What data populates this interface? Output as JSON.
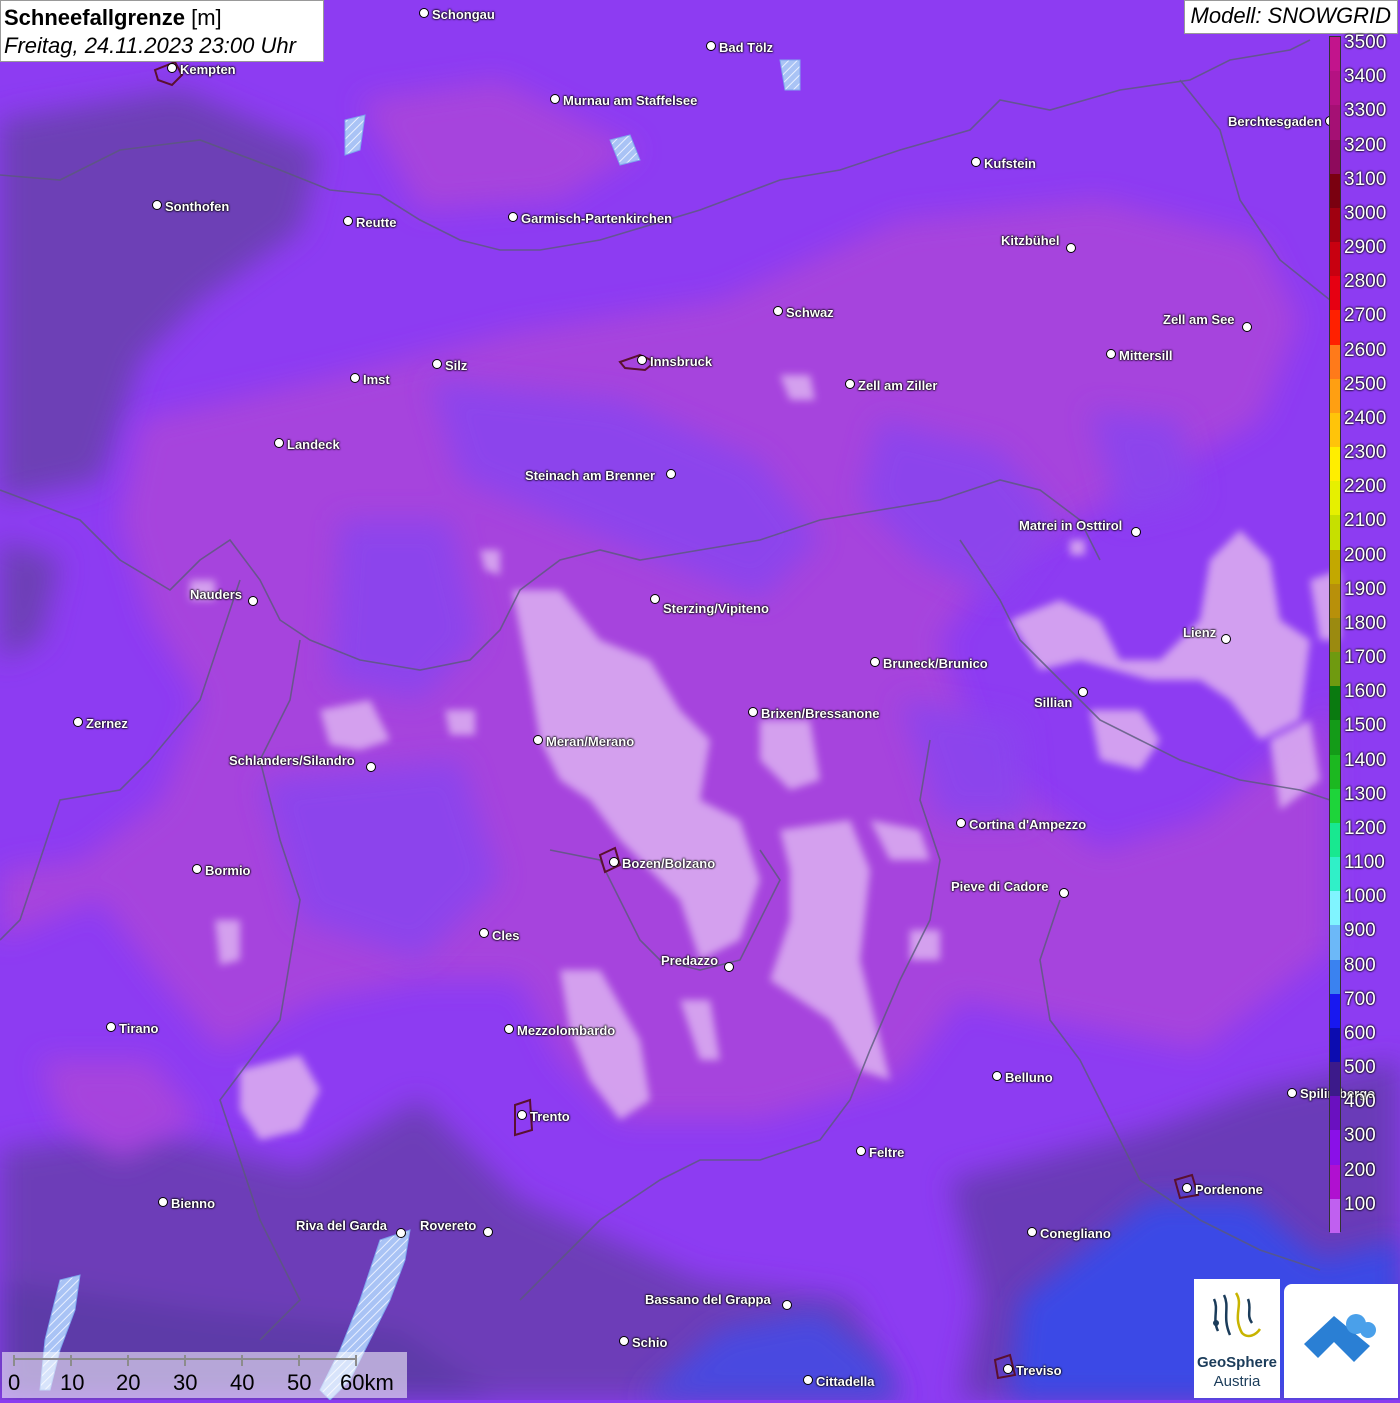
{
  "title": {
    "param": "Schneefallgrenze",
    "unit": "[m]",
    "datetime": "Freitag, 24.11.2023 23:00 Uhr"
  },
  "model": "Modell: SNOWGRID",
  "legend": {
    "labels": [
      "3500",
      "3400",
      "3300",
      "3200",
      "3100",
      "3000",
      "2900",
      "2800",
      "2700",
      "2600",
      "2500",
      "2400",
      "2300",
      "2200",
      "2100",
      "2000",
      "1900",
      "1800",
      "1700",
      "1600",
      "1500",
      "1400",
      "1300",
      "1200",
      "1100",
      "1000",
      "900",
      "800",
      "700",
      "600",
      "500",
      "400",
      "300",
      "200",
      "100"
    ],
    "colors": [
      "#c2148c",
      "#b51282",
      "#a51074",
      "#8e0a5c",
      "#7a0010",
      "#a00010",
      "#c80010",
      "#e60012",
      "#ff2000",
      "#ff7a1a",
      "#ff9f12",
      "#ffc40a",
      "#ffee00",
      "#e6f000",
      "#c6e000",
      "#c3a800",
      "#b8900a",
      "#9b8a10",
      "#6f9a10",
      "#0a7a10",
      "#149b18",
      "#1cb820",
      "#1ed43a",
      "#18e890",
      "#30f0c8",
      "#80f4ff",
      "#6cb8f8",
      "#3a82f0",
      "#1818f0",
      "#0c0cb0",
      "#3c1a8a",
      "#6a10c0",
      "#8a10e8",
      "#b010d0",
      "#c060f0"
    ]
  },
  "cities": [
    {
      "name": "Schongau",
      "dot": [
        424,
        13
      ],
      "label": [
        432,
        15
      ],
      "anchor": "left"
    },
    {
      "name": "Kempten",
      "dot": [
        172,
        68
      ],
      "label": [
        180,
        70
      ],
      "anchor": "left"
    },
    {
      "name": "Bad Tölz",
      "dot": [
        711,
        46
      ],
      "label": [
        719,
        48
      ],
      "anchor": "left"
    },
    {
      "name": "Murnau am Staffelsee",
      "dot": [
        555,
        99
      ],
      "label": [
        563,
        101
      ],
      "anchor": "left"
    },
    {
      "name": "Berchtesgaden",
      "dot": [
        1330,
        121
      ],
      "label": [
        1228,
        122
      ],
      "anchor": "left"
    },
    {
      "name": "Kufstein",
      "dot": [
        976,
        162
      ],
      "label": [
        984,
        164
      ],
      "anchor": "left"
    },
    {
      "name": "Sonthofen",
      "dot": [
        157,
        205
      ],
      "label": [
        165,
        207
      ],
      "anchor": "left"
    },
    {
      "name": "Reutte",
      "dot": [
        348,
        221
      ],
      "label": [
        356,
        223
      ],
      "anchor": "left"
    },
    {
      "name": "Garmisch-Partenkirchen",
      "dot": [
        513,
        217
      ],
      "label": [
        521,
        219
      ],
      "anchor": "left"
    },
    {
      "name": "Kitzbühel",
      "dot": [
        1071,
        248
      ],
      "label": [
        1001,
        241
      ],
      "anchor": "left"
    },
    {
      "name": "Schwaz",
      "dot": [
        778,
        311
      ],
      "label": [
        786,
        313
      ],
      "anchor": "left"
    },
    {
      "name": "Zell am See",
      "dot": [
        1247,
        327
      ],
      "label": [
        1163,
        320
      ],
      "anchor": "left"
    },
    {
      "name": "Mittersill",
      "dot": [
        1111,
        354
      ],
      "label": [
        1119,
        356
      ],
      "anchor": "left"
    },
    {
      "name": "Innsbruck",
      "dot": [
        642,
        360
      ],
      "label": [
        650,
        362
      ],
      "anchor": "left"
    },
    {
      "name": "Silz",
      "dot": [
        437,
        364
      ],
      "label": [
        445,
        366
      ],
      "anchor": "left"
    },
    {
      "name": "Imst",
      "dot": [
        355,
        378
      ],
      "label": [
        363,
        380
      ],
      "anchor": "left"
    },
    {
      "name": "Zell am Ziller",
      "dot": [
        850,
        384
      ],
      "label": [
        858,
        386
      ],
      "anchor": "left"
    },
    {
      "name": "Landeck",
      "dot": [
        279,
        443
      ],
      "label": [
        287,
        445
      ],
      "anchor": "left"
    },
    {
      "name": "Steinach am Brenner",
      "dot": [
        671,
        474
      ],
      "label": [
        525,
        476
      ],
      "anchor": "left"
    },
    {
      "name": "Matrei in Osttirol",
      "dot": [
        1136,
        532
      ],
      "label": [
        1019,
        526
      ],
      "anchor": "left"
    },
    {
      "name": "Nauders",
      "dot": [
        253,
        601
      ],
      "label": [
        190,
        595
      ],
      "anchor": "left"
    },
    {
      "name": "Sterzing/Vipiteno",
      "dot": [
        655,
        599
      ],
      "label": [
        663,
        609
      ],
      "anchor": "left"
    },
    {
      "name": "Lienz",
      "dot": [
        1226,
        639
      ],
      "label": [
        1183,
        633
      ],
      "anchor": "left"
    },
    {
      "name": "Bruneck/Brunico",
      "dot": [
        875,
        662
      ],
      "label": [
        883,
        664
      ],
      "anchor": "left"
    },
    {
      "name": "Sillian",
      "dot": [
        1083,
        692
      ],
      "label": [
        1034,
        703
      ],
      "anchor": "left"
    },
    {
      "name": "Brixen/Bressanone",
      "dot": [
        753,
        712
      ],
      "label": [
        761,
        714
      ],
      "anchor": "left"
    },
    {
      "name": "Zernez",
      "dot": [
        78,
        722
      ],
      "label": [
        86,
        724
      ],
      "anchor": "left"
    },
    {
      "name": "Meran/Merano",
      "dot": [
        538,
        740
      ],
      "label": [
        546,
        742
      ],
      "anchor": "left"
    },
    {
      "name": "Schlanders/Silandro",
      "dot": [
        371,
        767
      ],
      "label": [
        229,
        761
      ],
      "anchor": "left"
    },
    {
      "name": "Cortina d'Ampezzo",
      "dot": [
        961,
        823
      ],
      "label": [
        969,
        825
      ],
      "anchor": "left"
    },
    {
      "name": "Bozen/Bolzano",
      "dot": [
        614,
        862
      ],
      "label": [
        622,
        864
      ],
      "anchor": "left"
    },
    {
      "name": "Bormio",
      "dot": [
        197,
        869
      ],
      "label": [
        205,
        871
      ],
      "anchor": "left"
    },
    {
      "name": "Pieve di Cadore",
      "dot": [
        1064,
        893
      ],
      "label": [
        951,
        887
      ],
      "anchor": "left"
    },
    {
      "name": "Cles",
      "dot": [
        484,
        933
      ],
      "label": [
        492,
        936
      ],
      "anchor": "left"
    },
    {
      "name": "Predazzo",
      "dot": [
        729,
        967
      ],
      "label": [
        661,
        961
      ],
      "anchor": "left"
    },
    {
      "name": "Tirano",
      "dot": [
        111,
        1027
      ],
      "label": [
        119,
        1029
      ],
      "anchor": "left"
    },
    {
      "name": "Mezzolombardo",
      "dot": [
        509,
        1029
      ],
      "label": [
        517,
        1031
      ],
      "anchor": "left"
    },
    {
      "name": "Belluno",
      "dot": [
        997,
        1076
      ],
      "label": [
        1005,
        1078
      ],
      "anchor": "left"
    },
    {
      "name": "Spilimbergo",
      "dot": [
        1292,
        1093
      ],
      "label": [
        1300,
        1094
      ],
      "anchor": "left"
    },
    {
      "name": "Trento",
      "dot": [
        522,
        1115
      ],
      "label": [
        530,
        1117
      ],
      "anchor": "left"
    },
    {
      "name": "Feltre",
      "dot": [
        861,
        1151
      ],
      "label": [
        869,
        1153
      ],
      "anchor": "left"
    },
    {
      "name": "Pordenone",
      "dot": [
        1187,
        1188
      ],
      "label": [
        1195,
        1190
      ],
      "anchor": "left"
    },
    {
      "name": "Bienno",
      "dot": [
        163,
        1202
      ],
      "label": [
        171,
        1204
      ],
      "anchor": "left"
    },
    {
      "name": "Riva del Garda",
      "dot": [
        401,
        1233
      ],
      "label": [
        296,
        1226
      ],
      "anchor": "left"
    },
    {
      "name": "Rovereto",
      "dot": [
        488,
        1232
      ],
      "label": [
        420,
        1226
      ],
      "anchor": "left"
    },
    {
      "name": "Conegliano",
      "dot": [
        1032,
        1232
      ],
      "label": [
        1040,
        1234
      ],
      "anchor": "left"
    },
    {
      "name": "Bassano del Grappa",
      "dot": [
        787,
        1305
      ],
      "label": [
        645,
        1300
      ],
      "anchor": "left"
    },
    {
      "name": "Schio",
      "dot": [
        624,
        1341
      ],
      "label": [
        632,
        1343
      ],
      "anchor": "left"
    },
    {
      "name": "Treviso",
      "dot": [
        1008,
        1369
      ],
      "label": [
        1016,
        1371
      ],
      "anchor": "left"
    },
    {
      "name": "Cittadella",
      "dot": [
        808,
        1380
      ],
      "label": [
        816,
        1382
      ],
      "anchor": "left"
    }
  ],
  "scale": {
    "labels": [
      "0",
      "10",
      "20",
      "30",
      "40",
      "50",
      "60km"
    ]
  },
  "logos": {
    "geosphere_line1": "GeoSphere",
    "geosphere_line2": "Austria"
  }
}
